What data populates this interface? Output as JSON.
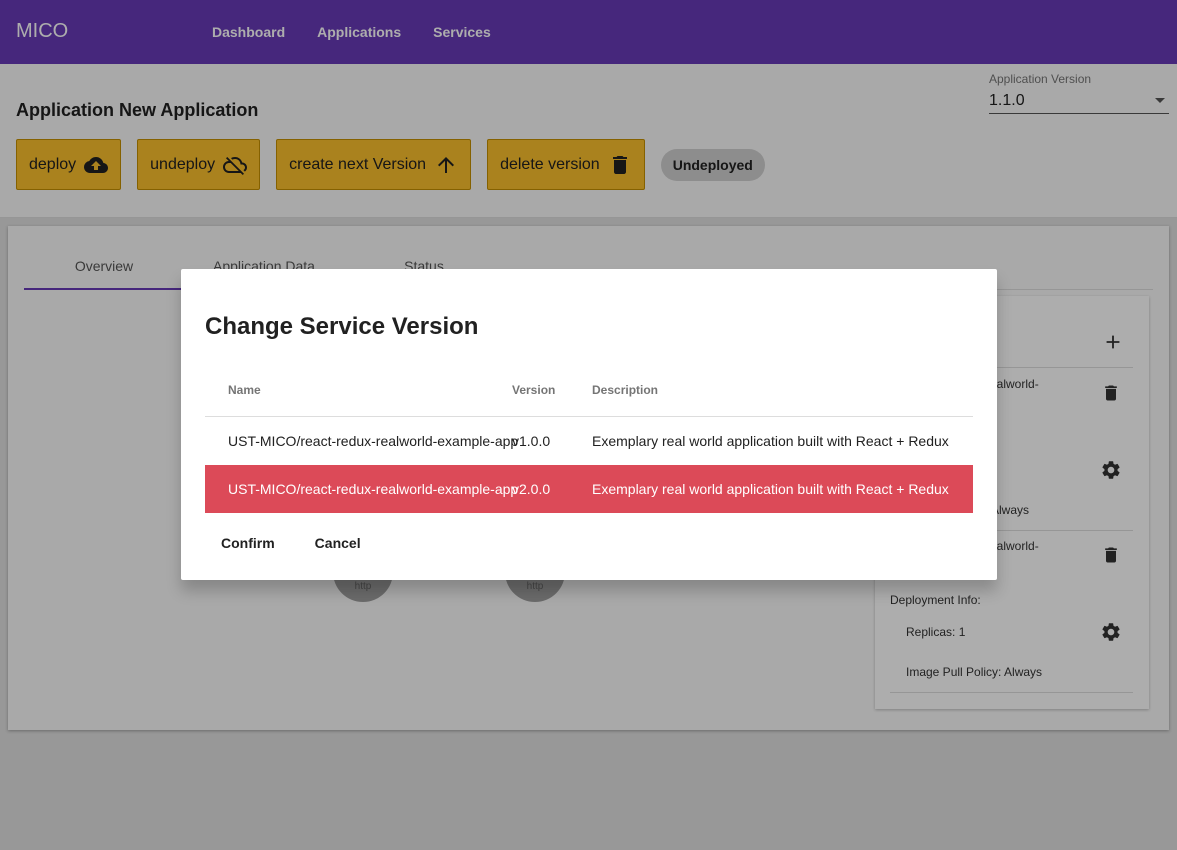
{
  "topbar": {
    "brand": "MICO",
    "nav": [
      "Dashboard",
      "Applications",
      "Services"
    ]
  },
  "header": {
    "title": "Application New Application",
    "version_label": "Application Version",
    "version_value": "1.1.0",
    "buttons": {
      "deploy": "deploy",
      "undeploy": "undeploy",
      "create_next": "create next Version",
      "delete": "delete version"
    },
    "status_chip": "Undeployed"
  },
  "tabs": [
    "Overview",
    "Application Data",
    "Status"
  ],
  "right_panel": {
    "service1_name_fragment": "ealworld-",
    "service1_pull": ": Always",
    "service2_name_fragment": "ealworld-",
    "deployment_info": "Deployment Info:",
    "replicas": "Replicas: 1",
    "pull_policy": "Image Pull Policy: Always"
  },
  "graph": {
    "node1_label": "http",
    "node2_label": "http"
  },
  "dialog": {
    "title": "Change Service Version",
    "columns": [
      "Name",
      "Version",
      "Description"
    ],
    "rows": [
      {
        "name": "UST-MICO/react-redux-realworld-example-app",
        "version": "v1.0.0",
        "description": "Exemplary real world application built with React + Redux"
      },
      {
        "name": "UST-MICO/react-redux-realworld-example-app",
        "version": "v2.0.0",
        "description": "Exemplary real world application built with React + Redux"
      }
    ],
    "confirm": "Confirm",
    "cancel": "Cancel"
  },
  "colors": {
    "primary": "#673ab7",
    "accent": "#fbc02d",
    "selected_row": "#dc4a58"
  }
}
